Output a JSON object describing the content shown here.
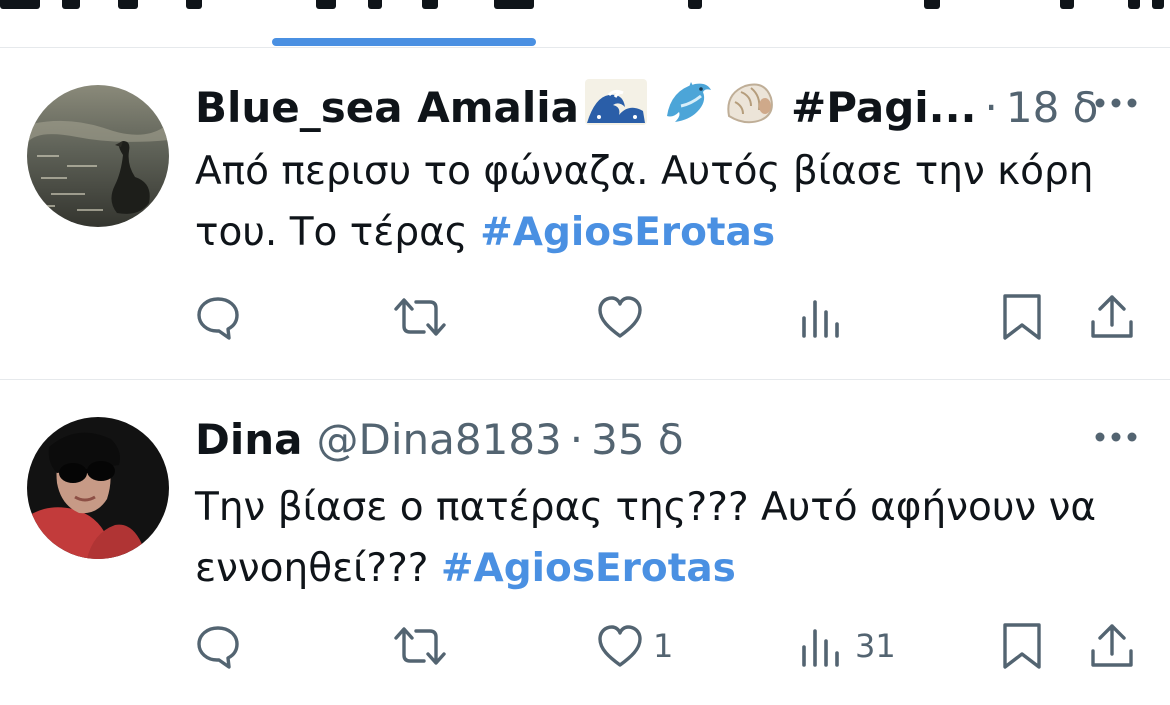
{
  "colors": {
    "accent": "#4a90e2",
    "text": "#0f1419",
    "secondary": "#536471",
    "divider": "#e6e9ec"
  },
  "tweets": [
    {
      "display_name": "Blue_sea Amalia",
      "name_emojis": [
        "🌊",
        "🐬",
        "🐚"
      ],
      "name_suffix": "#Pagi...",
      "handle": "",
      "separator": "·",
      "time": "18 δ",
      "text": "Από περισυ το φώναζα. Αυτός βίασε την κόρη του. Το τέρας ",
      "hashtag": "#AgiosErotas",
      "avatar_icon": "swan-on-lake-avatar",
      "actions": {
        "reply": {
          "icon": "reply-icon",
          "count": ""
        },
        "retweet": {
          "icon": "retweet-icon",
          "count": ""
        },
        "like": {
          "icon": "heart-icon",
          "count": ""
        },
        "views": {
          "icon": "views-icon",
          "count": ""
        },
        "bookmark": {
          "icon": "bookmark-icon"
        },
        "share": {
          "icon": "share-icon"
        }
      }
    },
    {
      "display_name": "Dina",
      "name_emojis": [],
      "name_suffix": "",
      "handle": "@Dina8183",
      "separator": "·",
      "time": "35 δ",
      "text": "Την βίασε ο πατέρας της??? Αυτό αφήνουν να εννοηθεί??? ",
      "hashtag": "#AgiosErotas",
      "avatar_icon": "person-sunglasses-avatar",
      "actions": {
        "reply": {
          "icon": "reply-icon",
          "count": ""
        },
        "retweet": {
          "icon": "retweet-icon",
          "count": ""
        },
        "like": {
          "icon": "heart-icon",
          "count": "1"
        },
        "views": {
          "icon": "views-icon",
          "count": "31"
        },
        "bookmark": {
          "icon": "bookmark-icon"
        },
        "share": {
          "icon": "share-icon"
        }
      }
    }
  ]
}
